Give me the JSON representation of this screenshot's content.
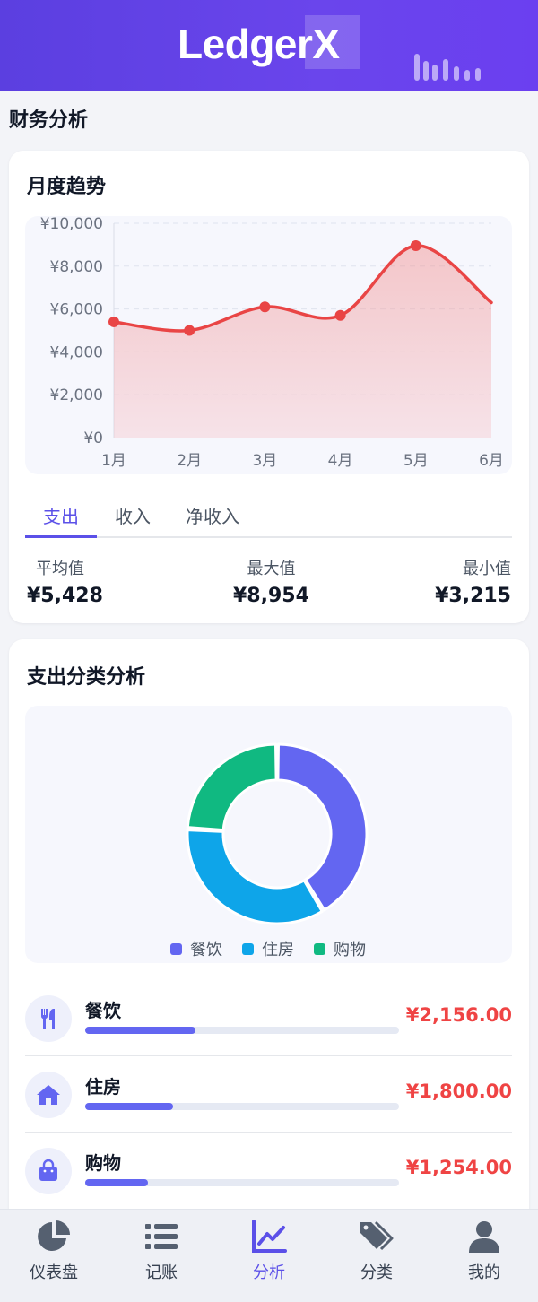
{
  "app": {
    "logo": "LedgerX"
  },
  "page": {
    "title": "财务分析"
  },
  "trend": {
    "title": "月度趋势",
    "tabs": [
      {
        "label": "支出",
        "active": true
      },
      {
        "label": "收入",
        "active": false
      },
      {
        "label": "净收入",
        "active": false
      }
    ],
    "stats": [
      {
        "label": "平均值",
        "value": "¥5,428"
      },
      {
        "label": "最大值",
        "value": "¥8,954"
      },
      {
        "label": "最小值",
        "value": "¥3,215"
      }
    ]
  },
  "categories": {
    "title": "支出分类分析",
    "items": [
      {
        "icon": "utensils-icon",
        "name": "餐饮",
        "amount": "¥2,156.00",
        "progress": 0.35
      },
      {
        "icon": "home-icon",
        "name": "住房",
        "amount": "¥1,800.00",
        "progress": 0.28
      },
      {
        "icon": "shopping-bag-icon",
        "name": "购物",
        "amount": "¥1,254.00",
        "progress": 0.2
      }
    ]
  },
  "nav": {
    "items": [
      {
        "label": "仪表盘",
        "icon": "pie-chart-icon",
        "active": false
      },
      {
        "label": "记账",
        "icon": "list-icon",
        "active": false
      },
      {
        "label": "分析",
        "icon": "line-chart-icon",
        "active": true
      },
      {
        "label": "分类",
        "icon": "tags-icon",
        "active": false
      },
      {
        "label": "我的",
        "icon": "user-icon",
        "active": false
      }
    ]
  },
  "colors": {
    "primary": "#5b50e8",
    "expense_line": "#e94545",
    "food": "#6366f1",
    "housing": "#0ea5e9",
    "shopping": "#10b981",
    "amount": "#ef4444"
  },
  "chart_data": [
    {
      "type": "area",
      "x": [
        "1月",
        "2月",
        "3月",
        "4月",
        "5月",
        "6月"
      ],
      "series": [
        {
          "values": [
            5400,
            5000,
            6100,
            5700,
            8954,
            6300
          ]
        }
      ],
      "ylim": [
        0,
        10000
      ],
      "yticks": [
        "¥0",
        "¥2,000",
        "¥4,000",
        "¥6,000",
        "¥8,000",
        "¥10,000"
      ],
      "grid": true
    },
    {
      "type": "pie",
      "categories": [
        "餐饮",
        "住房",
        "购物"
      ],
      "values": [
        2156,
        1800,
        1254
      ],
      "legend": "bottom"
    }
  ]
}
